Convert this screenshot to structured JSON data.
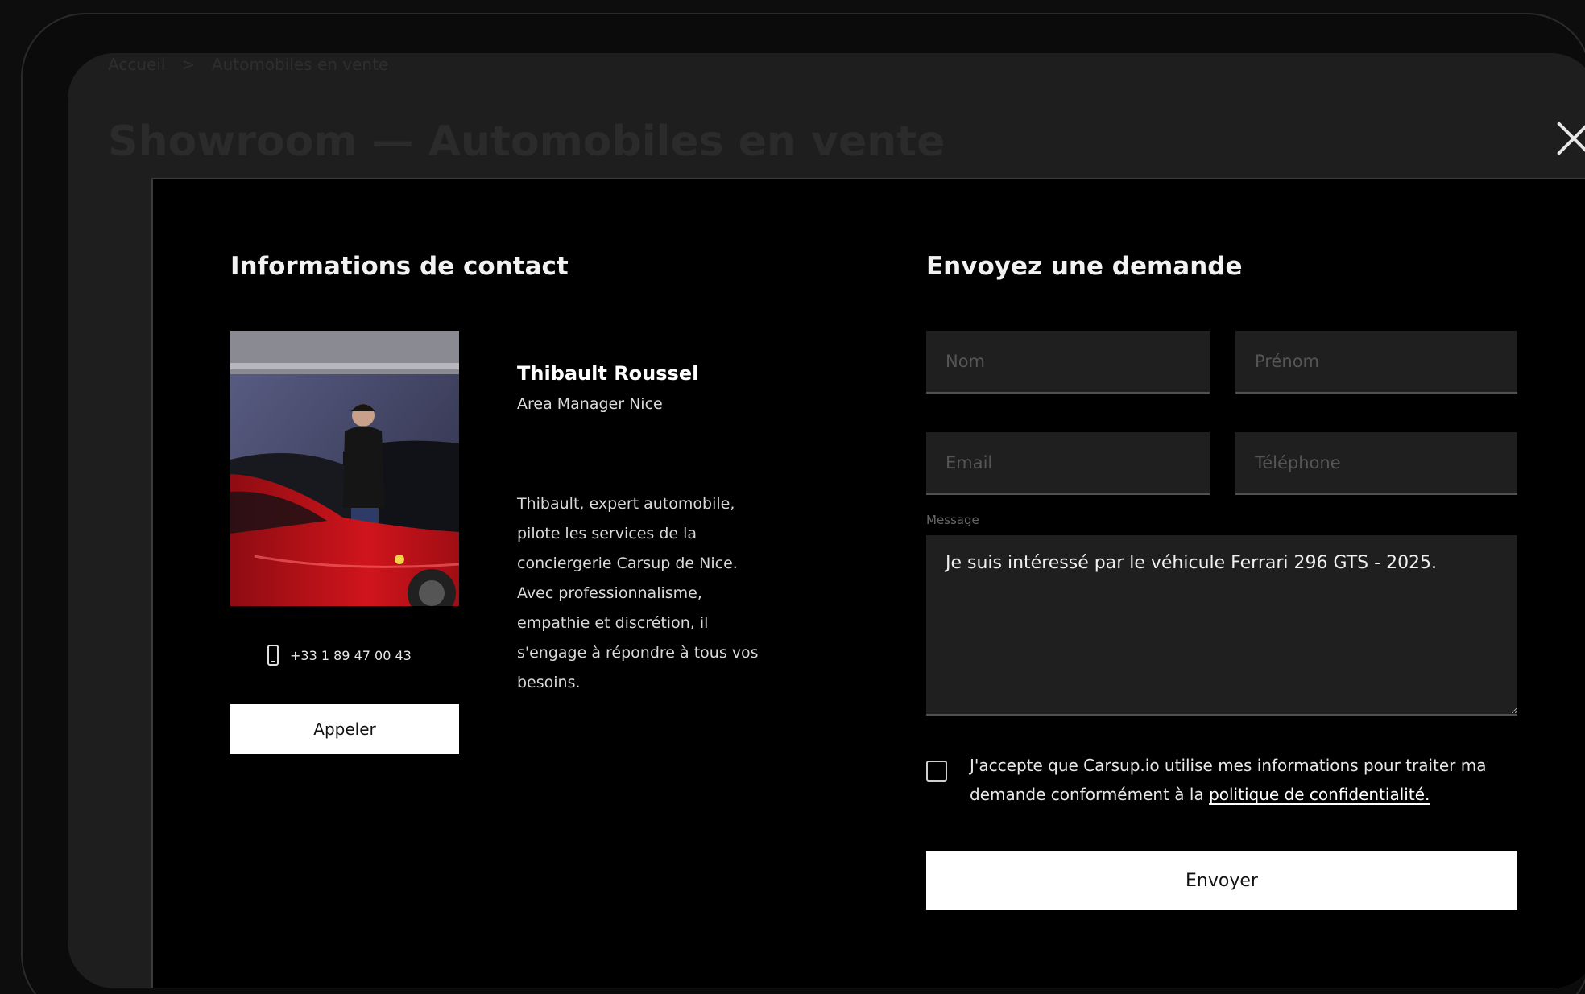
{
  "background": {
    "breadcrumb": [
      "Accueil",
      ">",
      "Automobiles en vente"
    ],
    "heading": "Showroom — Automobiles en vente"
  },
  "contact": {
    "title": "Informations de contact",
    "name": "Thibault Roussel",
    "role": "Area Manager Nice",
    "bio": "Thibault, expert automobile, pilote les services de la conciergerie Carsup de Nice. Avec professionnalisme, empathie et discrétion, il s'engage à répondre à tous vos besoins.",
    "phone": "+33 1 89 47 00 43",
    "call_label": "Appeler"
  },
  "form": {
    "title": "Envoyez une demande",
    "nom_placeholder": "Nom",
    "prenom_placeholder": "Prénom",
    "email_placeholder": "Email",
    "telephone_placeholder": "Téléphone",
    "message_label": "Message",
    "message_value": "Je suis intéressé par le véhicule Ferrari 296 GTS - 2025.",
    "consent_text": "J'accepte que Carsup.io utilise mes informations pour traiter ma demande conformément à la ",
    "consent_link": "politique de confidentialité.",
    "submit_label": "Envoyer"
  },
  "colors": {
    "modal_bg": "#000000",
    "backdrop": "#1e1e1e",
    "field_bg": "#1f1f1f",
    "button_bg": "#ffffff",
    "car_red": "#c8141c"
  },
  "icons": [
    "close-icon",
    "phone-icon",
    "checkbox-icon"
  ]
}
